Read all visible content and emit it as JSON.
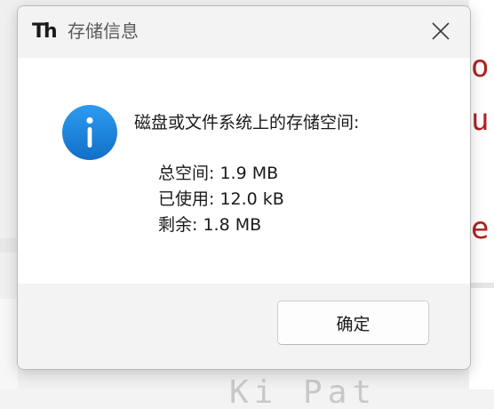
{
  "dialog": {
    "title": "存储信息",
    "app_icon_glyph": "Th",
    "close_icon": "close-icon",
    "message": "磁盘或文件系统上的存储空间:",
    "details": [
      {
        "label": "总空间",
        "value": "1.9 MB",
        "text": "总空间: 1.9 MB"
      },
      {
        "label": "已使用",
        "value": "12.0 kB",
        "text": "已使用: 12.0 kB"
      },
      {
        "label": "剩余",
        "value": "1.8 MB",
        "text": "剩余: 1.8 MB"
      }
    ],
    "ok_label": "确定",
    "info_icon": "info-icon",
    "accent_color": "#1a7fd6"
  },
  "background": {
    "code_chars": [
      "o",
      "u",
      "e"
    ],
    "bottom_text": "Ki    Pat"
  }
}
